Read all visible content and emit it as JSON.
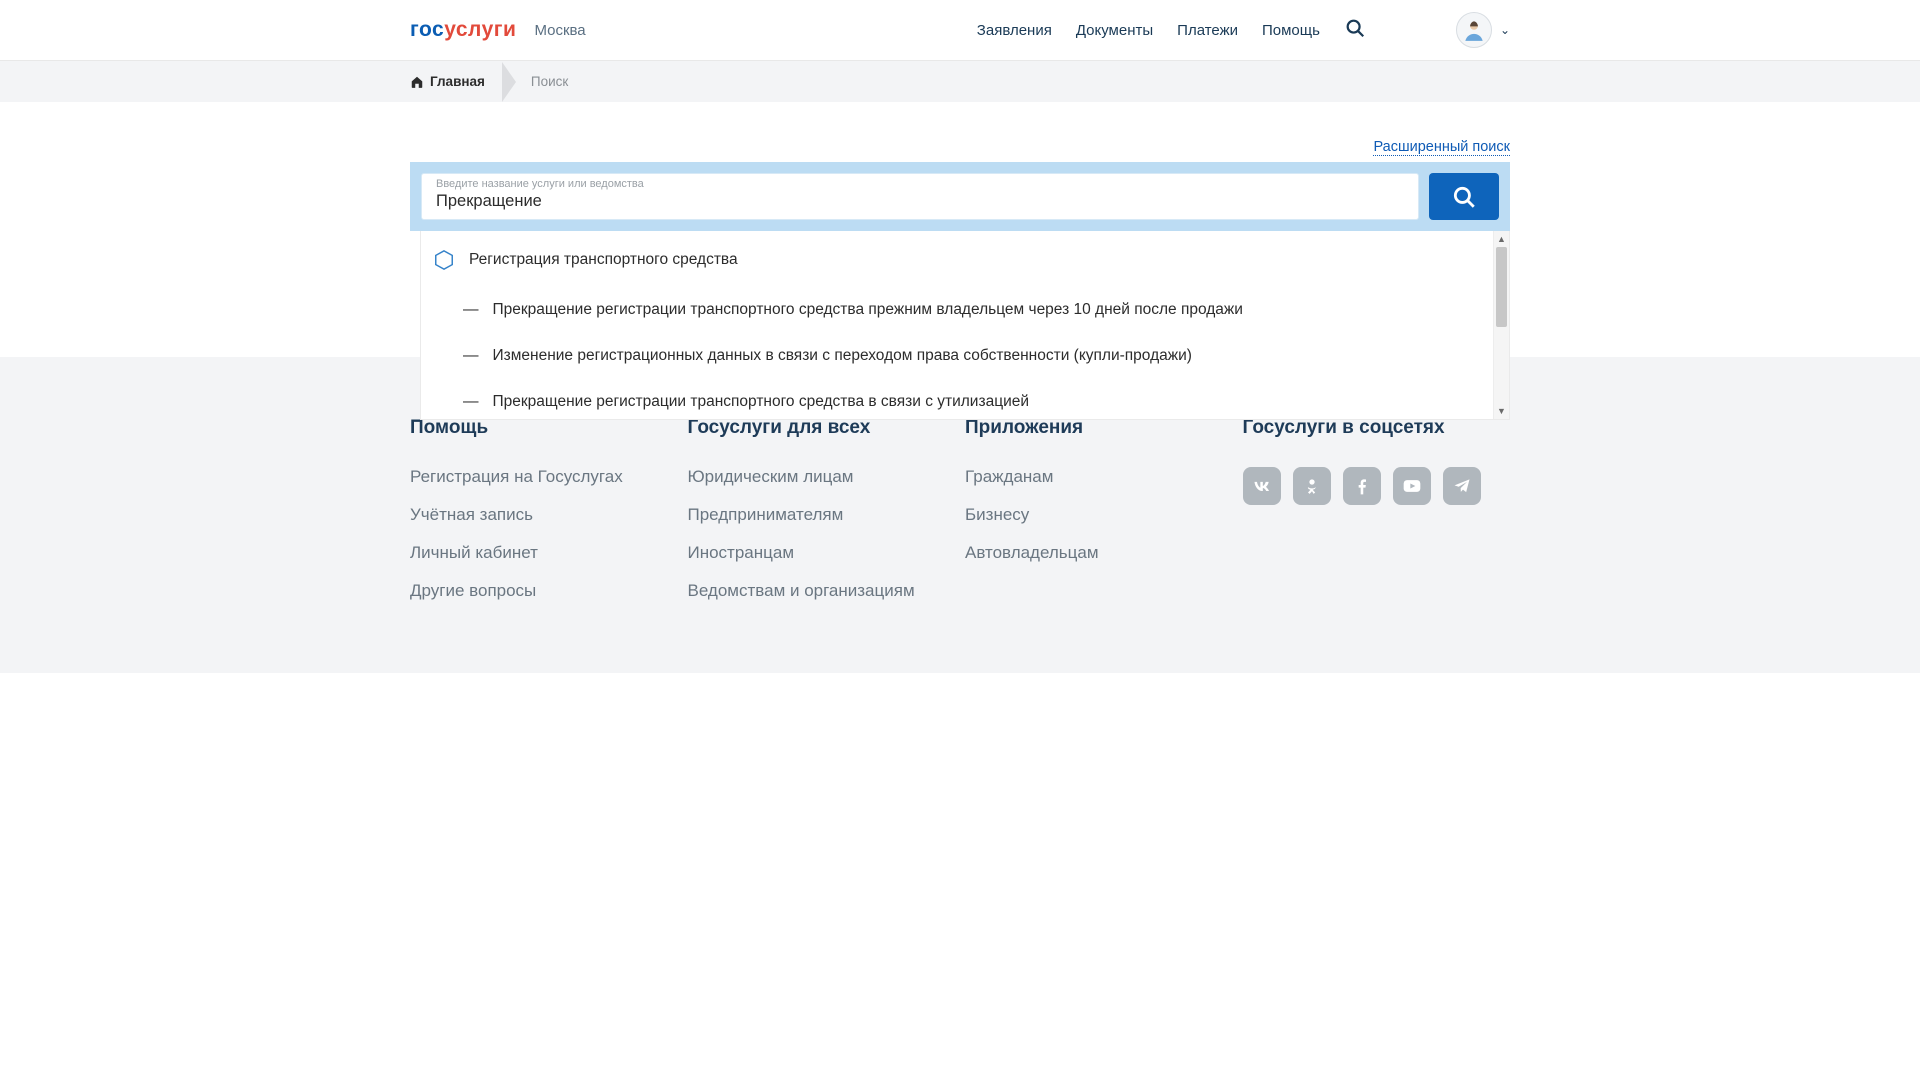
{
  "header": {
    "logo_part1": "гос",
    "logo_part2": "услуги",
    "city": "Москва",
    "nav": {
      "applications": "Заявления",
      "documents": "Документы",
      "payments": "Платежи",
      "help": "Помощь"
    }
  },
  "breadcrumbs": {
    "home": "Главная",
    "current": "Поиск"
  },
  "search": {
    "advanced_link": "Расширенный поиск",
    "placeholder": "Введите название услуги или ведомства",
    "value": "Прекращение"
  },
  "suggestions": {
    "category": "Регистрация транспортного средства",
    "items": [
      "Прекращение регистрации транспортного средства прежним владельцем через 10 дней после продажи",
      "Изменение регистрационных данных в связи с переходом права собственности (купли-продажи)",
      "Прекращение регистрации транспортного средства в связи с утилизацией"
    ]
  },
  "footer": {
    "col1": {
      "title": "Помощь",
      "links": [
        "Регистрация на Госуслугах",
        "Учётная запись",
        "Личный кабинет",
        "Другие вопросы"
      ]
    },
    "col2": {
      "title": "Госуслуги для всех",
      "links": [
        "Юридическим лицам",
        "Предпринимателям",
        "Иностранцам",
        "Ведомствам и организациям"
      ]
    },
    "col3": {
      "title": "Приложения",
      "links": [
        "Гражданам",
        "Бизнесу",
        "Автовладельцам"
      ]
    },
    "col4": {
      "title": "Госуслуги в соцсетях"
    }
  }
}
